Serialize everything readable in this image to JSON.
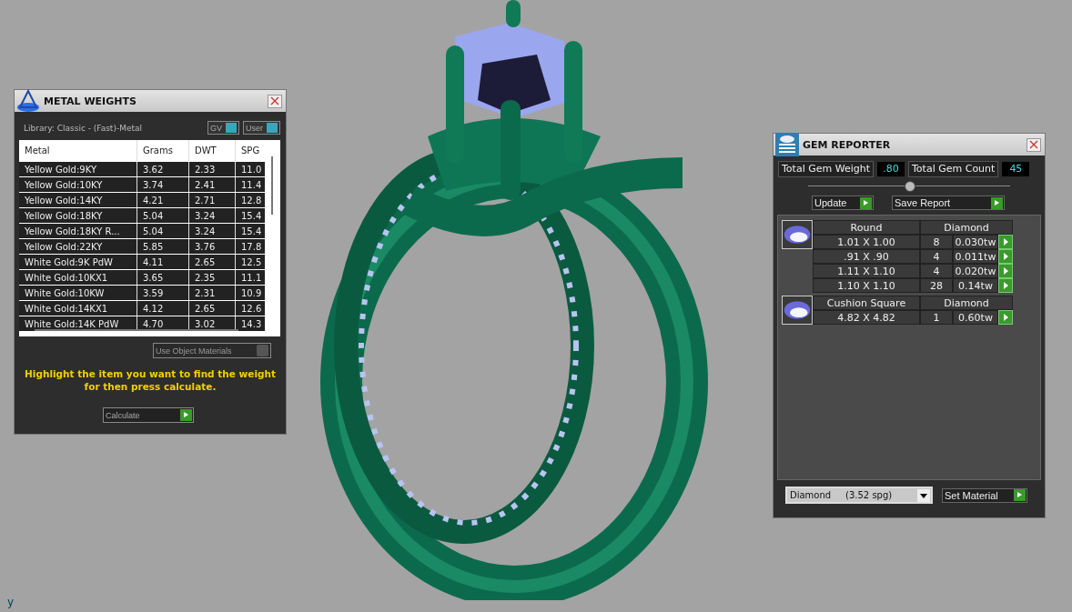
{
  "metal_weights": {
    "title": "METAL WEIGHTS",
    "library": "Library: Classic - (Fast)-Metal",
    "toggles": [
      {
        "label": "GV",
        "on": true
      },
      {
        "label": "User",
        "on": true
      }
    ],
    "columns": [
      "Metal",
      "Grams",
      "DWT",
      "SPG"
    ],
    "rows": [
      [
        "Yellow Gold:9KY",
        "3.62",
        "2.33",
        "11.0"
      ],
      [
        "Yellow Gold:10KY",
        "3.74",
        "2.41",
        "11.4"
      ],
      [
        "Yellow Gold:14KY",
        "4.21",
        "2.71",
        "12.8"
      ],
      [
        "Yellow Gold:18KY",
        "5.04",
        "3.24",
        "15.4"
      ],
      [
        "Yellow Gold:18KY R...",
        "5.04",
        "3.24",
        "15.4"
      ],
      [
        "Yellow Gold:22KY",
        "5.85",
        "3.76",
        "17.8"
      ],
      [
        "White Gold:9K PdW",
        "4.11",
        "2.65",
        "12.5"
      ],
      [
        "White Gold:10KX1",
        "3.65",
        "2.35",
        "11.1"
      ],
      [
        "White Gold:10KW",
        "3.59",
        "2.31",
        "10.9"
      ],
      [
        "White Gold:14KX1",
        "4.12",
        "2.65",
        "12.6"
      ],
      [
        "White Gold:14K PdW",
        "4.70",
        "3.02",
        "14.3"
      ]
    ],
    "use_object_materials": {
      "label": "Use Object Materials",
      "on": false
    },
    "instruction": "Highlight the item you want to find the weight for then press calculate.",
    "button": "Calculate"
  },
  "gem_reporter": {
    "title": "GEM REPORTER",
    "total_weight": {
      "label": "Total Gem Weight",
      "value": ".80"
    },
    "total_count": {
      "label": "Total Gem Count",
      "value": "45"
    },
    "buttons": [
      "Update",
      "Save Report"
    ],
    "groups": [
      {
        "shape": "Round",
        "material": "Diamond",
        "rows": [
          {
            "size": "1.01 X 1.00",
            "count": "8",
            "weight": "0.030tw"
          },
          {
            "size": ".91 X .90",
            "count": "4",
            "weight": "0.011tw"
          },
          {
            "size": "1.11 X 1.10",
            "count": "4",
            "weight": "0.020tw"
          },
          {
            "size": "1.10 X 1.10",
            "count": "28",
            "weight": "0.14tw"
          }
        ]
      },
      {
        "shape": "Cushion Square",
        "material": "Diamond",
        "rows": [
          {
            "size": "4.82 X 4.82",
            "count": "1",
            "weight": "0.60tw"
          }
        ]
      }
    ],
    "material_select": "Diamond     (3.52 spg)",
    "set_button": "Set Material"
  },
  "axis_label": "y"
}
